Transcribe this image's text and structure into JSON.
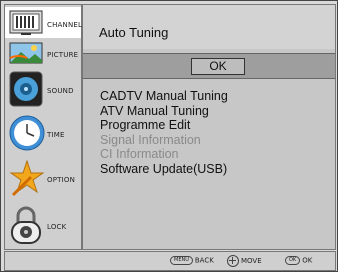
{
  "sidebar": {
    "items": [
      {
        "label": "CHANNEL",
        "icon": "tv-screen-icon"
      },
      {
        "label": "PICTURE",
        "icon": "picture-icon"
      },
      {
        "label": "SOUND",
        "icon": "speaker-icon"
      },
      {
        "label": "TIME",
        "icon": "clock-icon"
      },
      {
        "label": "OPTION",
        "icon": "star-icon"
      },
      {
        "label": "LOCK",
        "icon": "padlock-icon"
      }
    ],
    "selected": "CHANNEL"
  },
  "main": {
    "title": "Auto Tuning",
    "ok_label": "OK",
    "menu": [
      {
        "label": "CADTV Manual Tuning",
        "enabled": true
      },
      {
        "label": "ATV Manual Tuning",
        "enabled": true
      },
      {
        "label": "Programme Edit",
        "enabled": true
      },
      {
        "label": "Signal Information",
        "enabled": false
      },
      {
        "label": "CI Information",
        "enabled": false
      },
      {
        "label": "Software Update(USB)",
        "enabled": true
      }
    ]
  },
  "footer": {
    "back_key": "MENU",
    "back_label": "BACK",
    "move_label": "MOVE",
    "ok_key": "OK",
    "ok_label": "OK"
  },
  "colors": {
    "background": "#d9d9d9",
    "ok_row": "#9e9e9e",
    "disabled_text": "#8a8a8a"
  }
}
